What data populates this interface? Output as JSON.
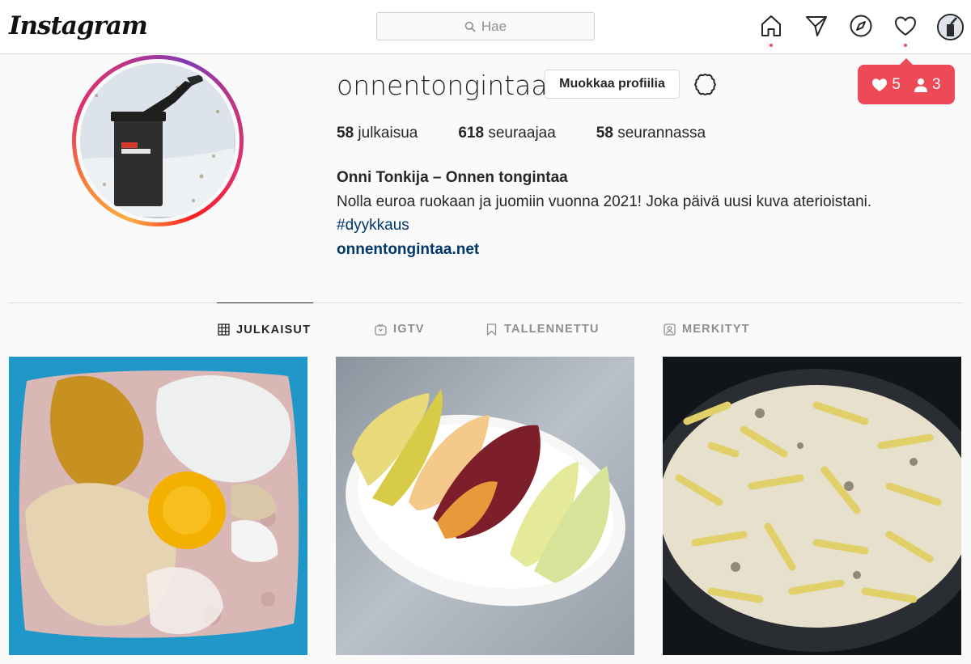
{
  "header": {
    "logo": "Instagram",
    "search_placeholder": "Hae"
  },
  "notifications": {
    "likes": "5",
    "followers": "3"
  },
  "profile": {
    "username": "onnentongintaa",
    "edit_button": "Muokkaa profiilia",
    "stats": [
      {
        "count": "58",
        "label": "julkaisua"
      },
      {
        "count": "618",
        "label": "seuraajaa"
      },
      {
        "count": "58",
        "label": "seurannassa"
      }
    ],
    "full_name": "Onni Tonkija – Onnen tongintaa",
    "bio": "Nolla euroa ruokaan ja juomiin vuonna 2021! Joka päivä uusi kuva aterioistani.",
    "hashtag": "#dyykkaus",
    "website": "onnentongintaa.net"
  },
  "tabs": [
    {
      "label": "JULKAISUT",
      "icon": "grid-icon",
      "active": true
    },
    {
      "label": "IGTV",
      "icon": "igtv-icon",
      "active": false
    },
    {
      "label": "TALLENNETTU",
      "icon": "bookmark-icon",
      "active": false
    },
    {
      "label": "MERKITYT",
      "icon": "tagged-icon",
      "active": false
    }
  ],
  "posts": [
    {
      "icon": "photo-minced-meat"
    },
    {
      "icon": "photo-fruit-plate"
    },
    {
      "icon": "photo-pan-dish"
    }
  ],
  "colors": {
    "accent": "#ed4956",
    "link": "#00376b",
    "border": "#dbdbdb"
  }
}
